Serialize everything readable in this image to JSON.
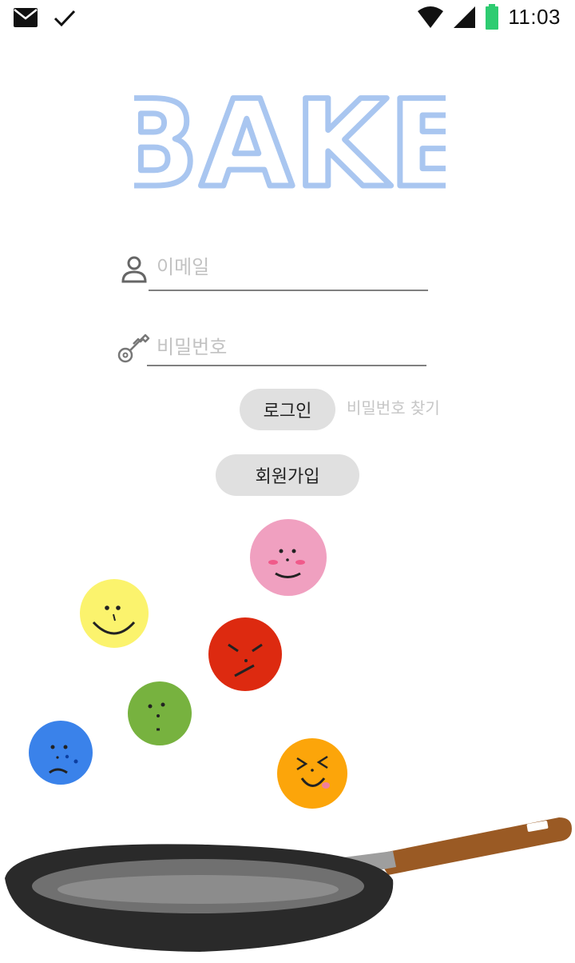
{
  "status_bar": {
    "time": "11:03",
    "icons": [
      "mail-icon",
      "check-icon",
      "wifi-icon",
      "cell-signal-icon",
      "battery-icon"
    ],
    "battery_color": "#2ecc71"
  },
  "logo": {
    "text": "BAKE",
    "color": "#a9c6f0"
  },
  "login_form": {
    "email_placeholder": "이메일",
    "password_placeholder": "비밀번호",
    "login_label": "로그인",
    "find_password_label": "비밀번호 찾기",
    "signup_label": "회원가입"
  },
  "illustration": {
    "faces": [
      {
        "name": "pink-face",
        "color": "#f0a0c0",
        "mood": "shy"
      },
      {
        "name": "yellow-face",
        "color": "#fbf36d",
        "mood": "happy"
      },
      {
        "name": "red-face",
        "color": "#dd2a10",
        "mood": "angry"
      },
      {
        "name": "green-face",
        "color": "#77b23f",
        "mood": "neutral"
      },
      {
        "name": "blue-face",
        "color": "#3a82ea",
        "mood": "sad"
      },
      {
        "name": "orange-face",
        "color": "#fca50a",
        "mood": "laughing"
      }
    ],
    "pan": {
      "body_color": "#2a2a2a",
      "handle_color": "#9a5a24"
    }
  }
}
